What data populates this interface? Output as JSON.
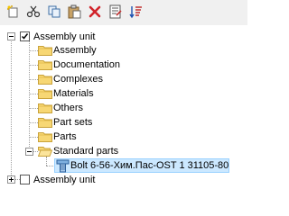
{
  "toolbar": {
    "buttons": [
      {
        "name": "new-icon"
      },
      {
        "name": "cut-icon"
      },
      {
        "name": "copy-icon"
      },
      {
        "name": "paste-icon"
      },
      {
        "name": "delete-icon"
      },
      {
        "name": "properties-icon"
      },
      {
        "name": "sort-icon"
      }
    ]
  },
  "tree": {
    "root1": {
      "label": "Assembly unit",
      "expanded": true,
      "checked": true
    },
    "folders": [
      {
        "label": "Assembly"
      },
      {
        "label": "Documentation"
      },
      {
        "label": "Complexes"
      },
      {
        "label": "Materials"
      },
      {
        "label": "Others"
      },
      {
        "label": "Part sets"
      },
      {
        "label": "Parts"
      },
      {
        "label": "Standard parts"
      }
    ],
    "standard_part_item": {
      "label": "Bolt 6-56-Хим.Пас-OST 1 31105-80",
      "selected": true
    },
    "root2": {
      "label": "Assembly unit",
      "expanded": false,
      "checked": false
    }
  },
  "colors": {
    "folder_fill": "#f7d774",
    "folder_edge": "#c9a23a",
    "selection": "#cce8ff"
  }
}
